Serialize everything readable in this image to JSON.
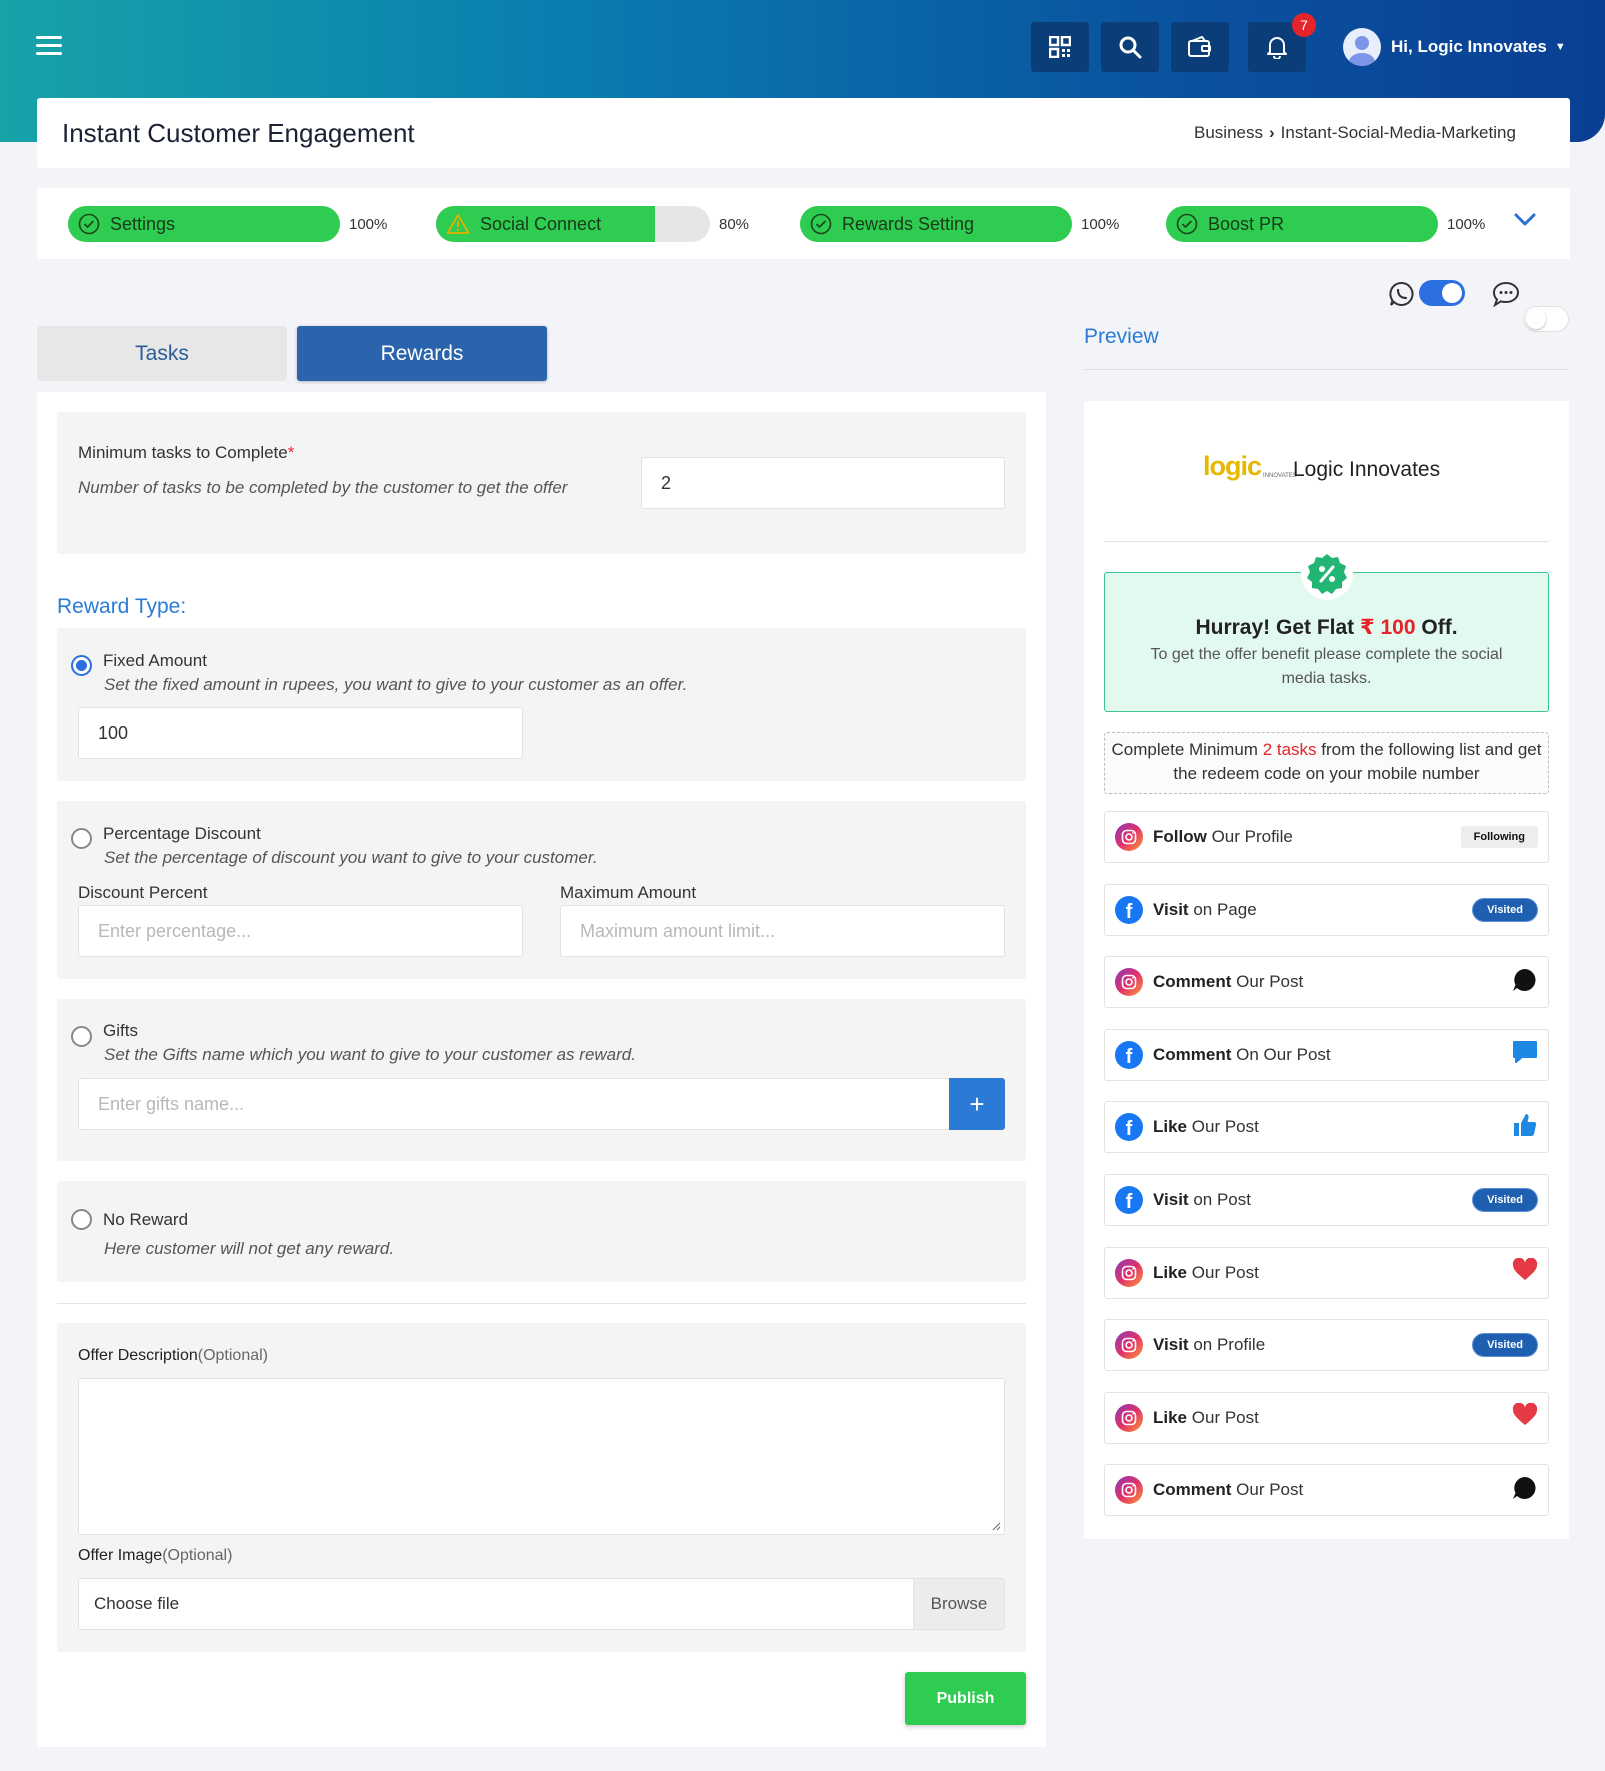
{
  "header": {
    "notification_count": "7",
    "user_greeting": "Hi, Logic Innovates",
    "icons": [
      "menu-icon",
      "qr-code-icon",
      "search-icon",
      "wallet-icon",
      "bell-icon",
      "chevron-down-icon"
    ]
  },
  "page": {
    "title": "Instant Customer Engagement",
    "breadcrumb": {
      "parent": "Business",
      "current": "Instant-Social-Media-Marketing"
    }
  },
  "steps": [
    {
      "label": "Settings",
      "percent_text": "100%",
      "progress": 1.0,
      "status": "complete"
    },
    {
      "label": "Social Connect",
      "percent_text": "80%",
      "progress": 0.8,
      "status": "warning"
    },
    {
      "label": "Rewards Setting",
      "percent_text": "100%",
      "progress": 1.0,
      "status": "complete"
    },
    {
      "label": "Boost PR",
      "percent_text": "100%",
      "progress": 1.0,
      "status": "complete"
    }
  ],
  "channel_toggles": {
    "whatsapp_on": true,
    "sms_on": false
  },
  "tabs": {
    "tasks": "Tasks",
    "rewards": "Rewards",
    "active": "rewards"
  },
  "form": {
    "min_tasks_label": "Minimum tasks to Complete",
    "required_mark": "*",
    "min_tasks_hint": "Number of tasks to be completed by the customer to get the offer",
    "min_tasks_value": "2",
    "reward_type_label": "Reward Type:",
    "fixed": {
      "label": "Fixed Amount",
      "hint": "Set the fixed amount in rupees, you want to give to your customer as an offer.",
      "value": "100",
      "selected": true
    },
    "percentage": {
      "label": "Percentage Discount",
      "hint": "Set the percentage of discount you want to give to your customer.",
      "discount_label": "Discount Percent",
      "discount_placeholder": "Enter percentage...",
      "max_label": "Maximum Amount",
      "max_placeholder": "Maximum amount limit..."
    },
    "gifts": {
      "label": "Gifts",
      "hint": "Set the Gifts name which you want to give to your customer as reward.",
      "placeholder": "Enter gifts name...",
      "add_label": "+"
    },
    "no_reward": {
      "label": "No Reward",
      "hint": "Here customer will not get any reward."
    },
    "offer_description_label": "Offer Description",
    "offer_image_label": "Offer Image",
    "optional_text": "(Optional)",
    "file_text": "Choose file",
    "browse_label": "Browse",
    "publish_label": "Publish"
  },
  "preview": {
    "title": "Preview",
    "logo_text": "logic",
    "logo_sub": "INNOVATES",
    "business_name": "Logic Innovates",
    "offer_prefix": "Hurray! Get Flat",
    "currency": "₹",
    "offer_amount": "100",
    "offer_suffix": "Off.",
    "offer_note": "To get the offer benefit please complete the social media tasks.",
    "instruction_pre": "Complete Minimum",
    "instruction_highlight": "2 tasks",
    "instruction_post": "from the following list and get the redeem code on your mobile number",
    "tasks": [
      {
        "platform": "instagram",
        "verb": "Follow",
        "text": "Our Profile",
        "status": "Following",
        "status_type": "pill-grey"
      },
      {
        "platform": "facebook",
        "verb": "Visit",
        "text": "on Page",
        "status": "Visited",
        "status_type": "pill-blue"
      },
      {
        "platform": "instagram",
        "verb": "Comment",
        "text": "Our Post",
        "status_icon": "comment-bubble-icon"
      },
      {
        "platform": "facebook",
        "verb": "Comment",
        "text": "On Our Post",
        "status_icon": "message-icon"
      },
      {
        "platform": "facebook",
        "verb": "Like",
        "text": "Our Post",
        "status_icon": "thumbs-up-icon"
      },
      {
        "platform": "facebook",
        "verb": "Visit",
        "text": "on Post",
        "status": "Visited",
        "status_type": "pill-blue"
      },
      {
        "platform": "instagram",
        "verb": "Like",
        "text": "Our Post",
        "status_icon": "heart-icon"
      },
      {
        "platform": "instagram",
        "verb": "Visit",
        "text": "on Profile",
        "status": "Visited",
        "status_type": "pill-blue"
      },
      {
        "platform": "instagram",
        "verb": "Like",
        "text": "Our Post",
        "status_icon": "heart-icon"
      },
      {
        "platform": "instagram",
        "verb": "Comment",
        "text": "Our Post",
        "status_icon": "comment-bubble-icon"
      }
    ]
  },
  "colors": {
    "primary": "#2a64ac",
    "success": "#2ecc50",
    "danger": "#e5232a",
    "accent_blue": "#2b7bd6"
  }
}
